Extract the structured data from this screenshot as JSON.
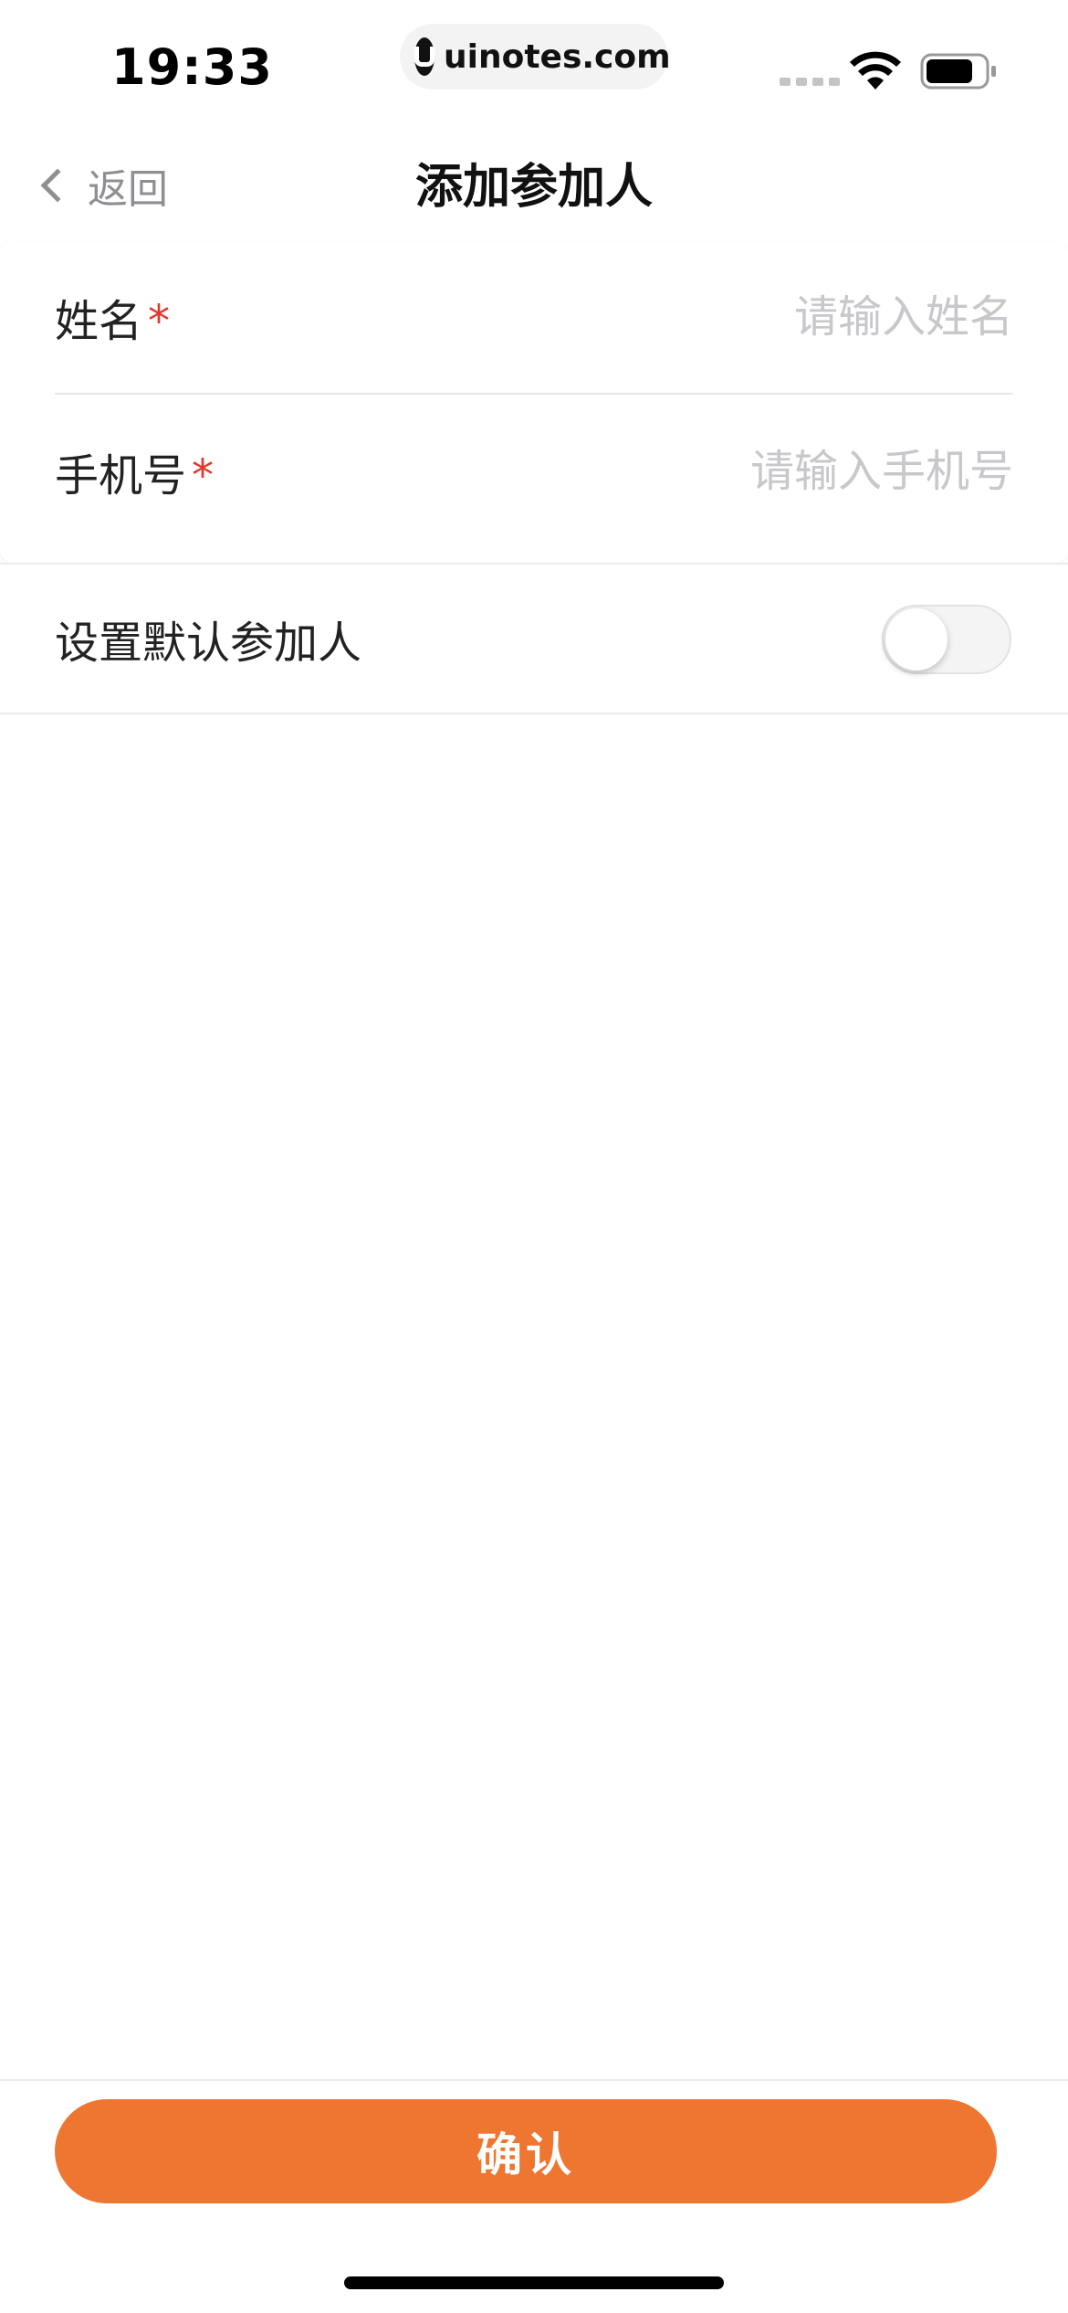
{
  "status_bar": {
    "time": "19:33",
    "url": "uinotes.com"
  },
  "nav": {
    "back_label": "返回",
    "title": "添加参加人"
  },
  "form": {
    "name": {
      "label": "姓名",
      "required_mark": "*",
      "value": "",
      "placeholder": "请输入姓名"
    },
    "phone": {
      "label": "手机号",
      "required_mark": "*",
      "value": "",
      "placeholder": "请输入手机号"
    }
  },
  "default_toggle": {
    "label": "设置默认参加人",
    "on": false
  },
  "confirm_button": {
    "label": "确认"
  },
  "colors": {
    "accent": "#ee7631",
    "required": "#e0392b",
    "placeholder": "#c7c7cc",
    "secondary_text": "#8e8e93"
  }
}
